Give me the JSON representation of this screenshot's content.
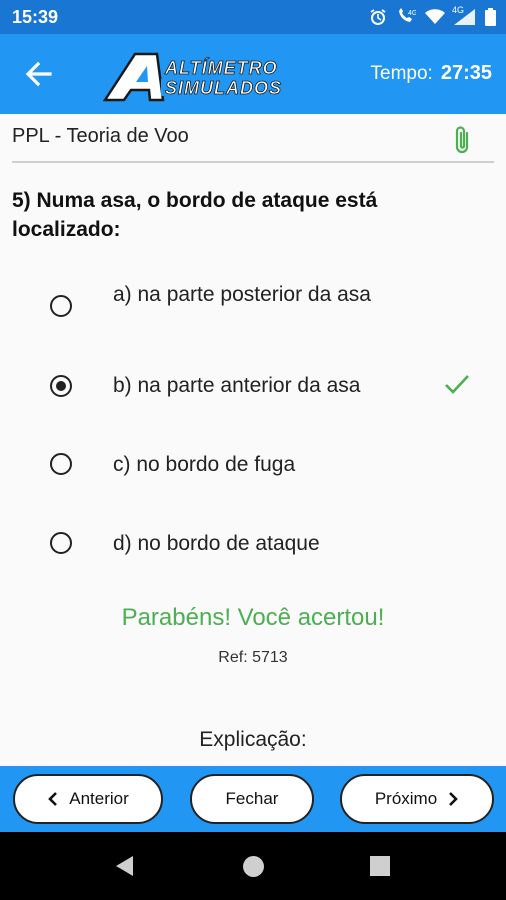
{
  "status_bar": {
    "time": "15:39",
    "network_label": "4G",
    "icons": [
      "alarm-icon",
      "wifi-call-icon",
      "wifi-icon",
      "signal-icon",
      "battery-icon"
    ]
  },
  "app_bar": {
    "logo_line1": "ALTÍMETRO",
    "logo_line2": "SIMULADOS",
    "timer_label": "Tempo:",
    "timer_value": "27:35",
    "color": "#2196f3"
  },
  "subject": "PPL  - Teoria de Voo",
  "question": "5) Numa asa, o bordo de ataque está localizado:",
  "options": [
    {
      "label": "a) na parte posterior da asa",
      "selected": false,
      "correct": false
    },
    {
      "label": "b) na parte anterior da asa",
      "selected": true,
      "correct": true
    },
    {
      "label": "c) no bordo de fuga",
      "selected": false,
      "correct": false
    },
    {
      "label": "d) no bordo de ataque",
      "selected": false,
      "correct": false
    }
  ],
  "feedback": "Parabéns! Você acertou!",
  "ref": "Ref: 5713",
  "explanation_title": "Explicação:",
  "buttons": {
    "previous": "Anterior",
    "close": "Fechar",
    "next": "Próximo"
  },
  "colors": {
    "status_bar": "#1976d2",
    "success": "#4caf50",
    "clip": "#4caf50"
  }
}
